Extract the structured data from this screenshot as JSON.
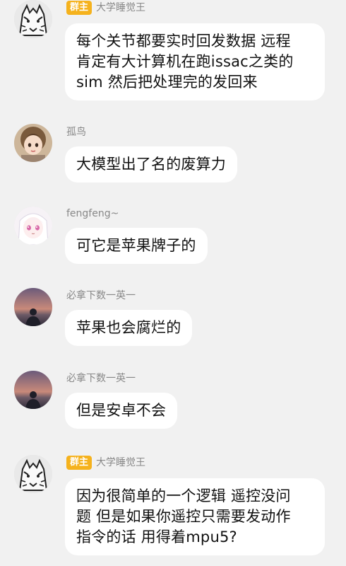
{
  "messages": [
    {
      "badge": "群主",
      "sender": "大学睡觉王",
      "text": "每个关节都要实时回发数据 远程\n肯定有大计算机在跑issac之类的\nsim 然后把处理完的发回来"
    },
    {
      "badge": "",
      "sender": "孤鸟",
      "text": "大模型出了名的废算力"
    },
    {
      "badge": "",
      "sender": "fengfeng~",
      "text": "可它是苹果牌子的"
    },
    {
      "badge": "",
      "sender": "必拿下数一英一",
      "text": "苹果也会腐烂的"
    },
    {
      "badge": "",
      "sender": "必拿下数一英一",
      "text": "但是安卓不会"
    },
    {
      "badge": "群主",
      "sender": "大学睡觉王",
      "text": "因为很简单的一个逻辑 遥控没问\n题 但是如果你遥控只需要发动作\n指令的话 用得着mpu5?"
    }
  ],
  "colors": {
    "background": "#f1f1f1",
    "bubble": "#ffffff",
    "badge": "#f5b21d",
    "nick": "#888888"
  },
  "icons": [
    "wolf-avatar-icon",
    "anime-girl-avatar-icon",
    "white-hair-girl-avatar-icon",
    "sunset-person-avatar-icon"
  ]
}
